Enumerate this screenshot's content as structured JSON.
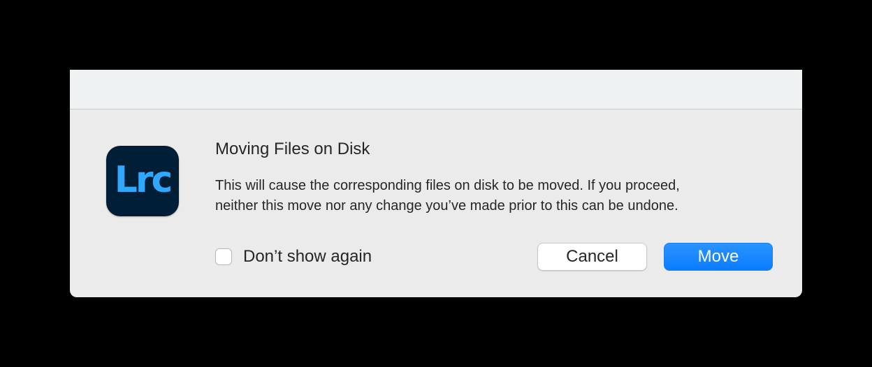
{
  "app_icon": {
    "label": "Lrc",
    "name": "lightroom-classic-icon"
  },
  "dialog": {
    "title": "Moving Files on Disk",
    "message_lines": [
      "This will cause the corresponding files on disk to be moved. If you proceed,",
      "neither this move nor any change you’ve made prior to this can be undone."
    ],
    "checkbox_label": "Don’t show again",
    "checkbox_checked": false,
    "cancel_label": "Cancel",
    "move_label": "Move"
  },
  "colors": {
    "accent": "#0a7cff",
    "icon_background": "#001e36",
    "icon_text": "#31a8ff"
  }
}
